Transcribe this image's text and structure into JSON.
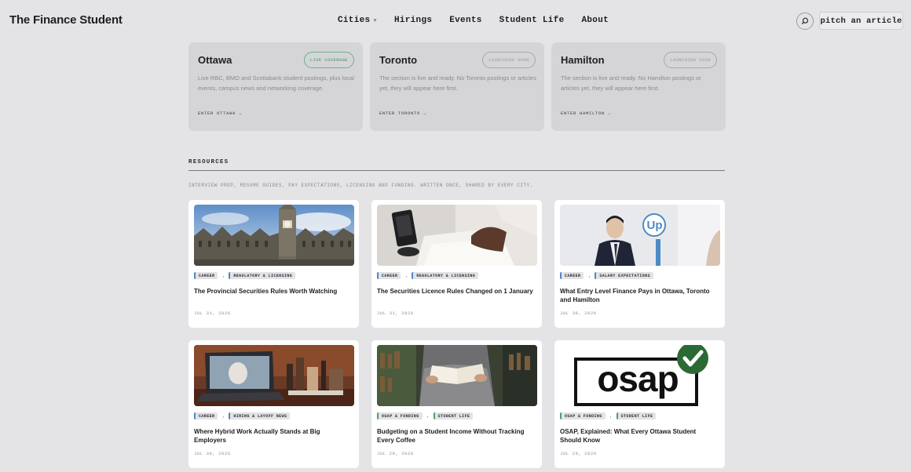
{
  "header": {
    "logo": "The Finance Student",
    "nav": [
      {
        "label": "Cities",
        "has_dropdown": true
      },
      {
        "label": "Hirings"
      },
      {
        "label": "Events"
      },
      {
        "label": "Student Life"
      },
      {
        "label": "About"
      }
    ],
    "search_icon": "search-icon",
    "pitch_label": "pitch an article"
  },
  "cities": [
    {
      "name": "Ottawa",
      "badge": "LIVE COVERAGE",
      "status": "live",
      "desc": "Live RBC, BMO and Scotiabank student postings, plus local events, campus news and networking coverage.",
      "enter": "ENTER OTTAWA →"
    },
    {
      "name": "Toronto",
      "badge": "LAUNCHING SOON",
      "status": "soon",
      "desc": "The section is live and ready. No Toronto postings or articles yet, they will appear here first.",
      "enter": "ENTER TORONTO →"
    },
    {
      "name": "Hamilton",
      "badge": "LAUNCHING SOON",
      "status": "soon",
      "desc": "The section is live and ready. No Hamilton postings or articles yet, they will appear here first.",
      "enter": "ENTER HAMILTON →"
    }
  ],
  "resources": {
    "title": "RESOURCES",
    "subtitle": "INTERVIEW PREP, RESUME GUIDES, PAY EXPECTATIONS, LICENSING AND FUNDING. WRITTEN ONCE, SHARED BY EVERY CITY.",
    "separator": ",",
    "articles": [
      {
        "tags": [
          "CAREER",
          "REGULATORY & LICENSING"
        ],
        "title": "The Provincial Securities Rules Worth Watching",
        "date": "JUL 31, 2026",
        "image": "parliament-photo"
      },
      {
        "tags": [
          "CAREER",
          "REGULATORY & LICENSING"
        ],
        "title": "The Securities Licence Rules Changed on 1 January",
        "date": "JUL 31, 2026",
        "image": "stamp-photo"
      },
      {
        "tags": [
          "CAREER",
          "SALARY EXPECTATIONS"
        ],
        "title": "What Entry Level Finance Pays in Ottawa, Toronto and Hamilton",
        "date": "JUL 30, 2026",
        "image": "interview-photo",
        "image_sign": "Up"
      },
      {
        "tags": [
          "CAREER",
          "HIRING & LAYOFF NEWS"
        ],
        "title": "Where Hybrid Work Actually Stands at Big Employers",
        "date": "JUL 30, 2026",
        "image": "laptop-desk-photo"
      },
      {
        "tags": [
          "OSAP & FUNDING",
          "STUDENT LIFE"
        ],
        "title": "Budgeting on a Student Income Without Tracking Every Coffee",
        "date": "JUL 29, 2026",
        "image": "book-reading-photo"
      },
      {
        "tags": [
          "OSAP & FUNDING",
          "STUDENT LIFE"
        ],
        "title": "OSAP, Explained: What Every Ottawa Student Should Know",
        "date": "JUL 29, 2026",
        "image": "osap-logo",
        "image_logo_text": "osap"
      }
    ]
  },
  "colors": {
    "background": "#e4e4e6",
    "card": "#ffffff",
    "city_card": "#d5d5d8",
    "live_accent": "#3e8f5e",
    "tag_blue": "#4b86c9",
    "tag_green": "#4aa36b",
    "osap_check": "#2b6a34"
  }
}
